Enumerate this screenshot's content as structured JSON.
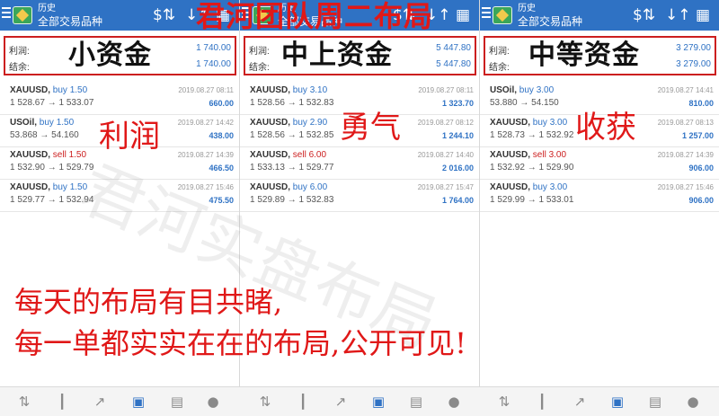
{
  "overlay": {
    "title": "君河团队周二布局",
    "words": [
      "利润",
      "勇气",
      "收获"
    ],
    "line1": "每天的布局有目共睹,",
    "line2": "每一单都实实在在的布局,公开可见!",
    "watermark": "君河实盘布局"
  },
  "panels": [
    {
      "header": {
        "title": "历史",
        "subtitle": "全部交易品种"
      },
      "summary": {
        "profit_label": "利润:",
        "profit": "1 740.00",
        "balance_label": "结余:",
        "balance": "1 740.00",
        "stamp": "小资金"
      },
      "trades": [
        {
          "symbol": "XAUUSD,",
          "side": "buy 1.50",
          "dir": "buy",
          "prices": "1 528.67 → 1 533.07",
          "time": "2019.08.27 08:11",
          "profit": "660.00"
        },
        {
          "symbol": "USOil,",
          "side": "buy 1.50",
          "dir": "buy",
          "prices": "53.868 → 54.160",
          "time": "2019.08.27 14:42",
          "profit": "438.00"
        },
        {
          "symbol": "XAUUSD,",
          "side": "sell 1.50",
          "dir": "sell",
          "prices": "1 532.90 → 1 529.79",
          "time": "2019.08.27 14:39",
          "profit": "466.50"
        },
        {
          "symbol": "XAUUSD,",
          "side": "buy 1.50",
          "dir": "buy",
          "prices": "1 529.77 → 1 532.94",
          "time": "2019.08.27 15:46",
          "profit": "475.50"
        }
      ]
    },
    {
      "header": {
        "title": "历史",
        "subtitle": "全部交易品种"
      },
      "summary": {
        "profit_label": "利润:",
        "profit": "5 447.80",
        "balance_label": "结余:",
        "balance": "5 447.80",
        "stamp": "中上资金"
      },
      "trades": [
        {
          "symbol": "XAUUSD,",
          "side": "buy 3.10",
          "dir": "buy",
          "prices": "1 528.56 → 1 532.83",
          "time": "2019.08.27 08:11",
          "profit": "1 323.70"
        },
        {
          "symbol": "XAUUSD,",
          "side": "buy 2.90",
          "dir": "buy",
          "prices": "1 528.56 → 1 532.85",
          "time": "2019.08.27 08:12",
          "profit": "1 244.10"
        },
        {
          "symbol": "XAUUSD,",
          "side": "sell 6.00",
          "dir": "sell",
          "prices": "1 533.13 → 1 529.77",
          "time": "2019.08.27 14:40",
          "profit": "2 016.00"
        },
        {
          "symbol": "XAUUSD,",
          "side": "buy 6.00",
          "dir": "buy",
          "prices": "1 529.89 → 1 532.83",
          "time": "2019.08.27 15:47",
          "profit": "1 764.00"
        }
      ]
    },
    {
      "header": {
        "title": "历史",
        "subtitle": "全部交易品种"
      },
      "summary": {
        "profit_label": "利润:",
        "profit": "3 279.00",
        "balance_label": "结余:",
        "balance": "3 279.00",
        "stamp": "中等资金"
      },
      "trades": [
        {
          "symbol": "USOil,",
          "side": "buy 3.00",
          "dir": "buy",
          "prices": "53.880 → 54.150",
          "time": "2019.08.27 14:41",
          "profit": "810.00"
        },
        {
          "symbol": "XAUUSD,",
          "side": "buy 3.00",
          "dir": "buy",
          "prices": "1 528.73 → 1 532.92",
          "time": "2019.08.27 08:13",
          "profit": "1 257.00"
        },
        {
          "symbol": "XAUUSD,",
          "side": "sell 3.00",
          "dir": "sell",
          "prices": "1 532.92 → 1 529.90",
          "time": "2019.08.27 14:39",
          "profit": "906.00"
        },
        {
          "symbol": "XAUUSD,",
          "side": "buy 3.00",
          "dir": "buy",
          "prices": "1 529.99 → 1 533.01",
          "time": "2019.08.27 15:46",
          "profit": "906.00"
        }
      ]
    }
  ],
  "icons": {
    "topbar": [
      "menu-icon",
      "app-logo-icon",
      "dollar-sort-icon",
      "sort-arrows-icon",
      "calendar-icon"
    ],
    "bottombar": [
      "quotes-icon",
      "chart-icon",
      "trade-icon",
      "history-icon",
      "news-icon",
      "chat-icon"
    ]
  },
  "colors": {
    "header": "#2f72c4",
    "accent_red": "#e01818",
    "profit_blue": "#2f72c4",
    "sell_red": "#cc1f1f"
  }
}
